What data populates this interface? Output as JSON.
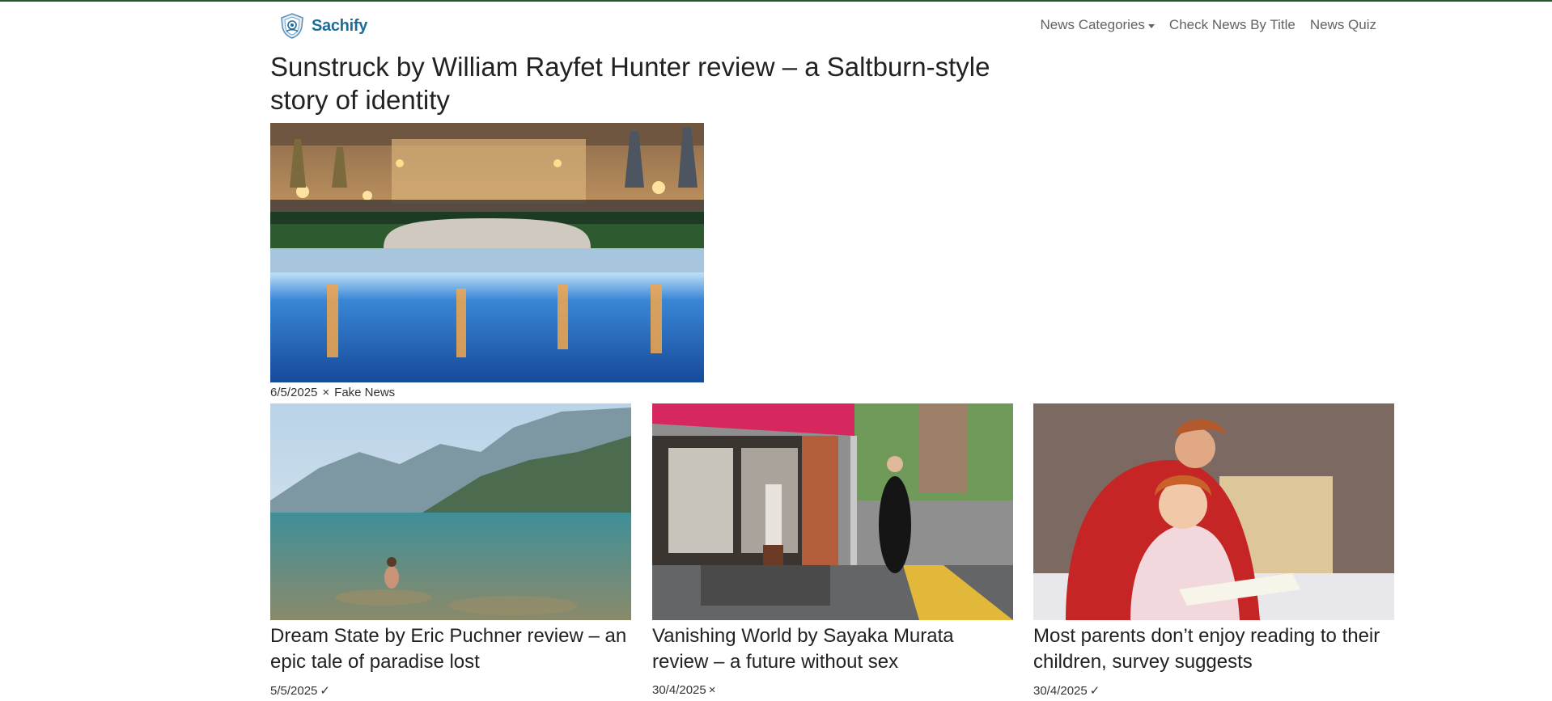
{
  "brand": {
    "name": "Sachify",
    "logo_icon": "shield-logo-icon"
  },
  "nav": {
    "categories": "News Categories",
    "check_title": "Check News By Title",
    "quiz": "News Quiz"
  },
  "hero": {
    "title": "Sunstruck by William Rayfet Hunter review – a Saltburn-style story of identity",
    "date": "6/5/2025",
    "mark": "×",
    "label": "Fake News"
  },
  "cards": [
    {
      "title": "Dream State by Eric Puchner review – an epic tale of paradise lost",
      "date": "5/5/2025",
      "mark": "✓"
    },
    {
      "title": "Vanishing World by Sayaka Murata review – a future without sex",
      "date": "30/4/2025",
      "mark": "×"
    },
    {
      "title": "Most parents don’t enjoy reading to their children, survey suggests",
      "date": "30/4/2025",
      "mark": "✓"
    }
  ],
  "colors": {
    "brand": "#1a6d9c",
    "top_line": "#1e5a2c"
  }
}
